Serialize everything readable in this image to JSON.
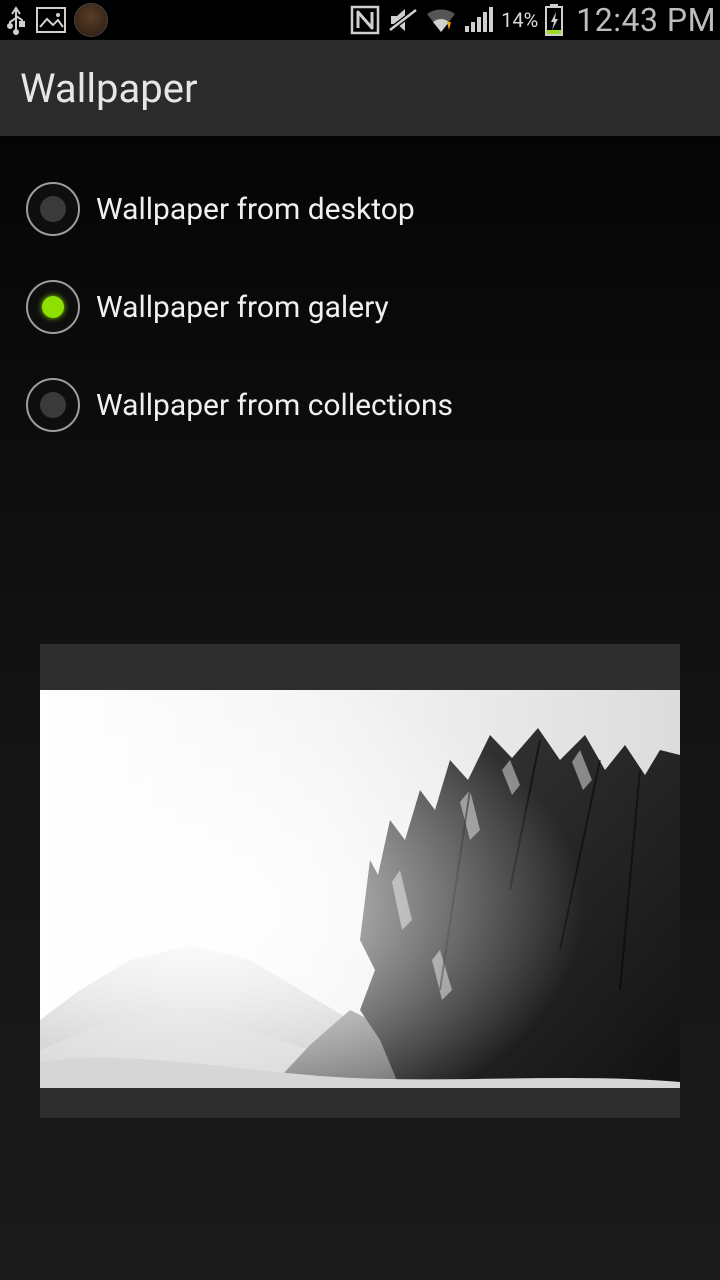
{
  "status": {
    "battery_percent": "14%",
    "clock": "12:43 PM"
  },
  "actionbar": {
    "title": "Wallpaper"
  },
  "options": {
    "items": [
      {
        "label": "Wallpaper from desktop",
        "selected": false
      },
      {
        "label": "Wallpaper from galery",
        "selected": true
      },
      {
        "label": "Wallpaper from collections",
        "selected": false
      }
    ]
  },
  "icons": {
    "usb": "usb-icon",
    "picture": "picture-icon",
    "app_badge": "app-badge-icon",
    "nfc": "nfc-icon",
    "mute": "mute-icon",
    "wifi": "wifi-icon",
    "signal": "signal-icon",
    "battery": "battery-charging-icon"
  },
  "preview": {
    "alt": "Black and white mountain landscape"
  }
}
